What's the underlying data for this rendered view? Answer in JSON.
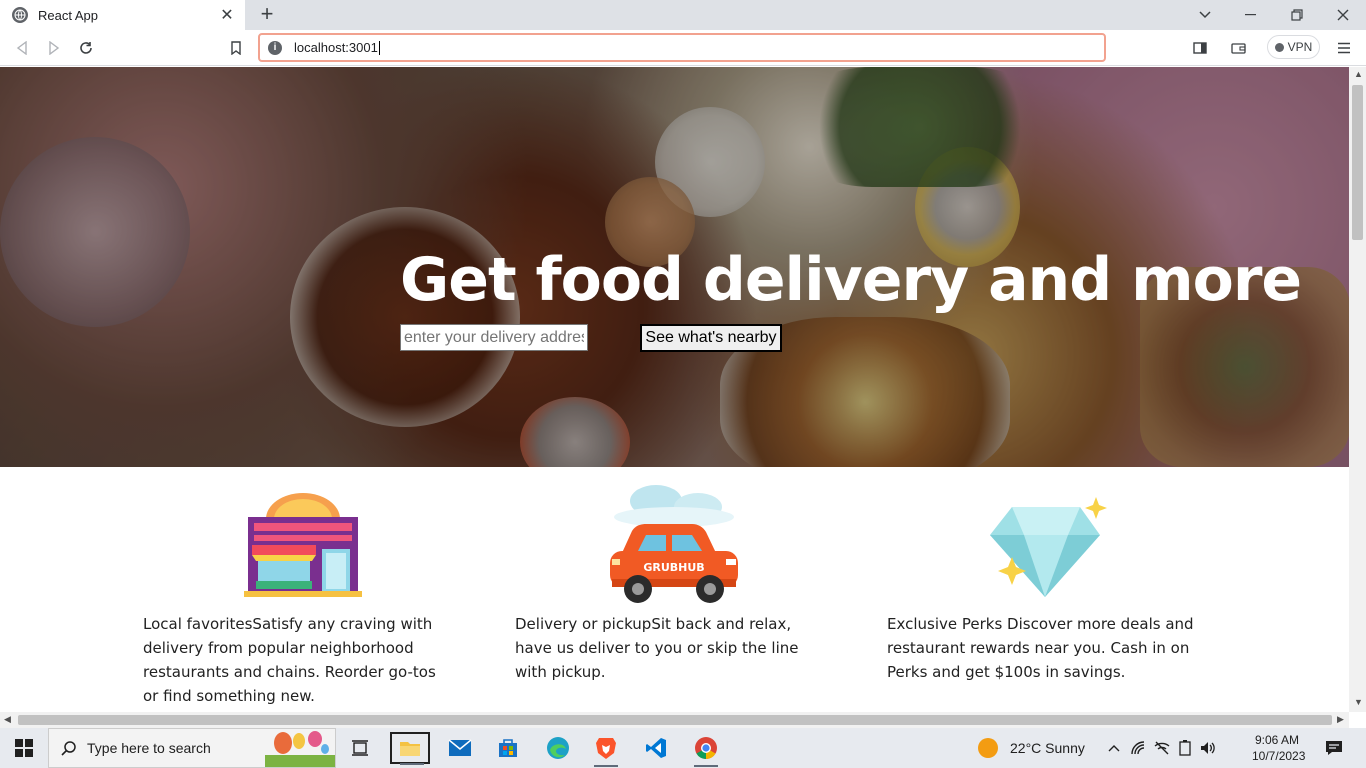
{
  "browser": {
    "tab_title": "React App",
    "url": "localhost:3001",
    "vpn_label": "VPN"
  },
  "hero": {
    "title": "Get food delivery and more",
    "address_placeholder": "enter your delivery address",
    "nearby_button": "See what's nearby",
    "image_subject": "overhead photo of takeout food on a pink table"
  },
  "features": [
    {
      "icon": "storefront-illustration",
      "text": "Local favoritesSatisfy any craving with delivery from popular neighborhood restaurants and chains. Reorder go-tos or find something new."
    },
    {
      "icon": "grubhub-car-illustration",
      "car_label": "GRUBHUB",
      "text": "Delivery or pickupSit back and relax, have us deliver to you or skip the line with pickup."
    },
    {
      "icon": "diamond-illustration",
      "text": "Exclusive Perks Discover more deals and restaurant rewards near you. Cash in on Perks and get $100s in savings."
    }
  ],
  "taskbar": {
    "search_placeholder": "Type here to search",
    "weather": "22°C  Sunny",
    "time": "9:06 AM",
    "date": "10/7/2023",
    "pinned_apps": [
      "task-view",
      "file-explorer",
      "mail",
      "microsoft-store",
      "edge",
      "brave",
      "vscode",
      "chrome"
    ]
  },
  "colors": {
    "url_focus_border": "#f2a28f",
    "hero_title": "#ffffff",
    "taskbar_bg": "#e7eaef",
    "car_orange": "#f15a24",
    "diamond": "#9fe0e6"
  }
}
